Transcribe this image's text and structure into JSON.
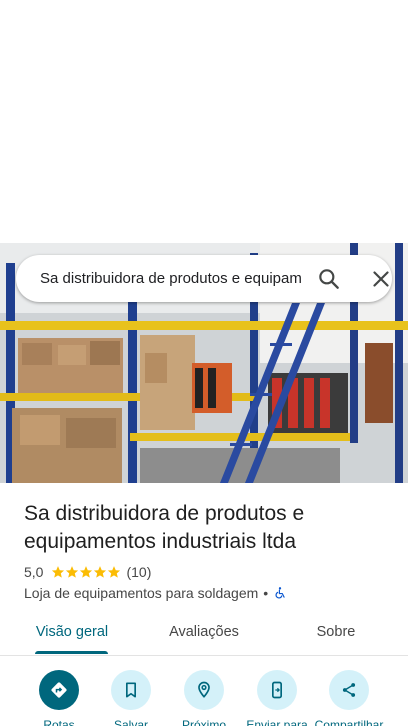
{
  "search": {
    "query": "Sa distribuidora de produtos e equipamentos industriais ltda",
    "search_icon": "search-icon",
    "close_icon": "close-icon"
  },
  "place": {
    "name": "Sa distribuidora de produtos e equipamentos industriais ltda",
    "rating": "5,0",
    "stars": 5,
    "review_count": "(10)",
    "category": "Loja de equipamentos para soldagem",
    "separator": "•",
    "accessibility_icon": "wheelchair-icon"
  },
  "tabs": [
    {
      "label": "Visão geral",
      "active": true
    },
    {
      "label": "Avaliações",
      "active": false
    },
    {
      "label": "Sobre",
      "active": false
    }
  ],
  "actions": [
    {
      "label": "Rotas",
      "icon": "directions-icon"
    },
    {
      "label": "Salvar",
      "icon": "bookmark-icon"
    },
    {
      "label": "Próximo",
      "icon": "nearby-icon"
    },
    {
      "label": "Enviar para",
      "icon": "send-to-phone-icon"
    },
    {
      "label": "Compartilhar",
      "icon": "share-icon"
    }
  ],
  "colors": {
    "accent": "#00677d",
    "accent_light": "#d4f1f9",
    "star": "#fbbc04"
  }
}
